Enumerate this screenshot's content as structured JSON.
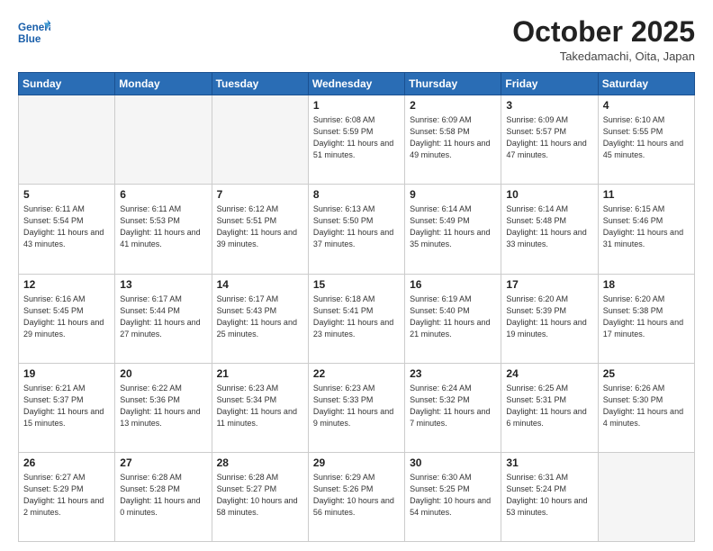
{
  "header": {
    "logo_line1": "General",
    "logo_line2": "Blue",
    "month_title": "October 2025",
    "subtitle": "Takedamachi, Oita, Japan"
  },
  "weekdays": [
    "Sunday",
    "Monday",
    "Tuesday",
    "Wednesday",
    "Thursday",
    "Friday",
    "Saturday"
  ],
  "weeks": [
    [
      {
        "day": "",
        "empty": true
      },
      {
        "day": "",
        "empty": true
      },
      {
        "day": "",
        "empty": true
      },
      {
        "day": "1",
        "sunrise": "6:08 AM",
        "sunset": "5:59 PM",
        "daylight": "11 hours and 51 minutes."
      },
      {
        "day": "2",
        "sunrise": "6:09 AM",
        "sunset": "5:58 PM",
        "daylight": "11 hours and 49 minutes."
      },
      {
        "day": "3",
        "sunrise": "6:09 AM",
        "sunset": "5:57 PM",
        "daylight": "11 hours and 47 minutes."
      },
      {
        "day": "4",
        "sunrise": "6:10 AM",
        "sunset": "5:55 PM",
        "daylight": "11 hours and 45 minutes."
      }
    ],
    [
      {
        "day": "5",
        "sunrise": "6:11 AM",
        "sunset": "5:54 PM",
        "daylight": "11 hours and 43 minutes."
      },
      {
        "day": "6",
        "sunrise": "6:11 AM",
        "sunset": "5:53 PM",
        "daylight": "11 hours and 41 minutes."
      },
      {
        "day": "7",
        "sunrise": "6:12 AM",
        "sunset": "5:51 PM",
        "daylight": "11 hours and 39 minutes."
      },
      {
        "day": "8",
        "sunrise": "6:13 AM",
        "sunset": "5:50 PM",
        "daylight": "11 hours and 37 minutes."
      },
      {
        "day": "9",
        "sunrise": "6:14 AM",
        "sunset": "5:49 PM",
        "daylight": "11 hours and 35 minutes."
      },
      {
        "day": "10",
        "sunrise": "6:14 AM",
        "sunset": "5:48 PM",
        "daylight": "11 hours and 33 minutes."
      },
      {
        "day": "11",
        "sunrise": "6:15 AM",
        "sunset": "5:46 PM",
        "daylight": "11 hours and 31 minutes."
      }
    ],
    [
      {
        "day": "12",
        "sunrise": "6:16 AM",
        "sunset": "5:45 PM",
        "daylight": "11 hours and 29 minutes."
      },
      {
        "day": "13",
        "sunrise": "6:17 AM",
        "sunset": "5:44 PM",
        "daylight": "11 hours and 27 minutes."
      },
      {
        "day": "14",
        "sunrise": "6:17 AM",
        "sunset": "5:43 PM",
        "daylight": "11 hours and 25 minutes."
      },
      {
        "day": "15",
        "sunrise": "6:18 AM",
        "sunset": "5:41 PM",
        "daylight": "11 hours and 23 minutes."
      },
      {
        "day": "16",
        "sunrise": "6:19 AM",
        "sunset": "5:40 PM",
        "daylight": "11 hours and 21 minutes."
      },
      {
        "day": "17",
        "sunrise": "6:20 AM",
        "sunset": "5:39 PM",
        "daylight": "11 hours and 19 minutes."
      },
      {
        "day": "18",
        "sunrise": "6:20 AM",
        "sunset": "5:38 PM",
        "daylight": "11 hours and 17 minutes."
      }
    ],
    [
      {
        "day": "19",
        "sunrise": "6:21 AM",
        "sunset": "5:37 PM",
        "daylight": "11 hours and 15 minutes."
      },
      {
        "day": "20",
        "sunrise": "6:22 AM",
        "sunset": "5:36 PM",
        "daylight": "11 hours and 13 minutes."
      },
      {
        "day": "21",
        "sunrise": "6:23 AM",
        "sunset": "5:34 PM",
        "daylight": "11 hours and 11 minutes."
      },
      {
        "day": "22",
        "sunrise": "6:23 AM",
        "sunset": "5:33 PM",
        "daylight": "11 hours and 9 minutes."
      },
      {
        "day": "23",
        "sunrise": "6:24 AM",
        "sunset": "5:32 PM",
        "daylight": "11 hours and 7 minutes."
      },
      {
        "day": "24",
        "sunrise": "6:25 AM",
        "sunset": "5:31 PM",
        "daylight": "11 hours and 6 minutes."
      },
      {
        "day": "25",
        "sunrise": "6:26 AM",
        "sunset": "5:30 PM",
        "daylight": "11 hours and 4 minutes."
      }
    ],
    [
      {
        "day": "26",
        "sunrise": "6:27 AM",
        "sunset": "5:29 PM",
        "daylight": "11 hours and 2 minutes."
      },
      {
        "day": "27",
        "sunrise": "6:28 AM",
        "sunset": "5:28 PM",
        "daylight": "11 hours and 0 minutes."
      },
      {
        "day": "28",
        "sunrise": "6:28 AM",
        "sunset": "5:27 PM",
        "daylight": "10 hours and 58 minutes."
      },
      {
        "day": "29",
        "sunrise": "6:29 AM",
        "sunset": "5:26 PM",
        "daylight": "10 hours and 56 minutes."
      },
      {
        "day": "30",
        "sunrise": "6:30 AM",
        "sunset": "5:25 PM",
        "daylight": "10 hours and 54 minutes."
      },
      {
        "day": "31",
        "sunrise": "6:31 AM",
        "sunset": "5:24 PM",
        "daylight": "10 hours and 53 minutes."
      },
      {
        "day": "",
        "empty": true
      }
    ]
  ]
}
